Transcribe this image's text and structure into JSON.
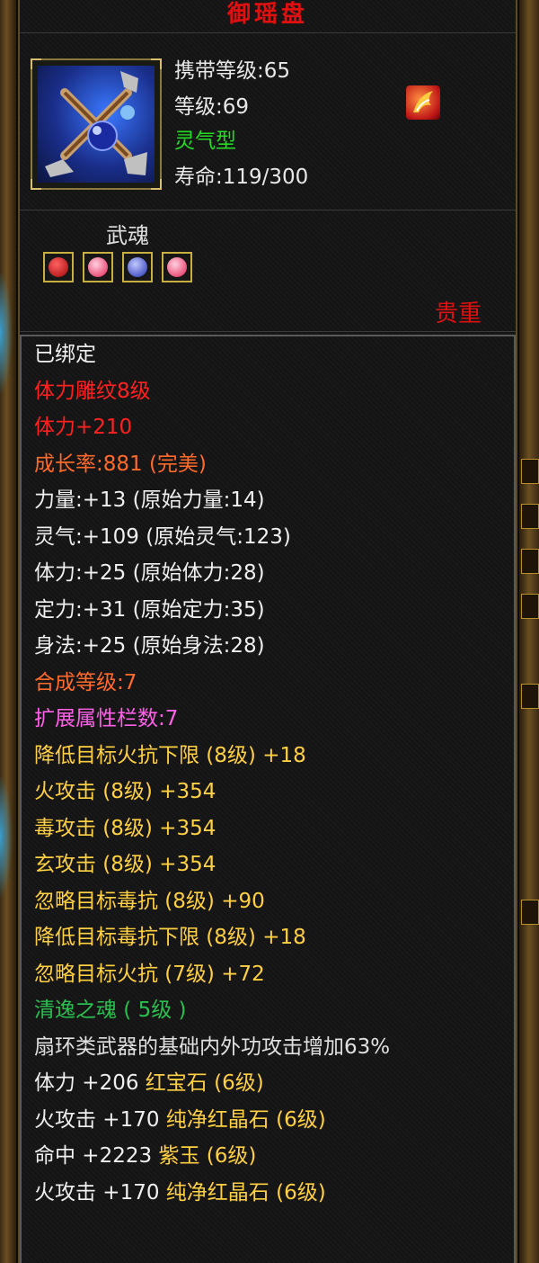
{
  "title": "御瑶盘",
  "item_icon": "fan-weapon-icon",
  "stats": [
    {
      "text": "携带等级:65",
      "color": "#e8e8e8"
    },
    {
      "text": "等级:69",
      "color": "#e8e8e8"
    },
    {
      "text": "灵气型",
      "color": "#22dd22"
    },
    {
      "text": "寿命:119/300",
      "color": "#e8e8e8"
    }
  ],
  "rarity_icon": "phoenix-flame-icon",
  "soul": {
    "label": "武魂",
    "gems": [
      {
        "icon": "red-soul-gem-icon",
        "color": "#cc1010"
      },
      {
        "icon": "fire-soul-gem-icon",
        "color": "#ff3060"
      },
      {
        "icon": "blue-soul-gem-icon",
        "color": "#3040d0"
      },
      {
        "icon": "fire-soul-gem-icon",
        "color": "#ff3060"
      }
    ]
  },
  "quality": "贵重",
  "attributes": [
    {
      "text": "已绑定",
      "color": "#f0f0f0"
    },
    {
      "text": "体力雕纹8级",
      "color": "#ff2020"
    },
    {
      "text": "体力+210",
      "color": "#ff2020"
    },
    {
      "text": "成长率:881 (完美)",
      "color": "#ff6a28"
    },
    {
      "text": "力量:+13 (原始力量:14)",
      "color": "#f0f0f0"
    },
    {
      "text": "灵气:+109 (原始灵气:123)",
      "color": "#f0f0f0"
    },
    {
      "text": "体力:+25 (原始体力:28)",
      "color": "#f0f0f0"
    },
    {
      "text": "定力:+31 (原始定力:35)",
      "color": "#f0f0f0"
    },
    {
      "text": "身法:+25 (原始身法:28)",
      "color": "#f0f0f0"
    },
    {
      "text": "合成等级:7",
      "color": "#ff6a28"
    },
    {
      "text": "扩展属性栏数:7",
      "color": "#ff60e8"
    },
    {
      "text": "降低目标火抗下限 (8级) +18",
      "color": "#ffd040"
    },
    {
      "text": "火攻击 (8级) +354",
      "color": "#ffd040"
    },
    {
      "text": "毒攻击 (8级) +354",
      "color": "#ffd040"
    },
    {
      "text": "玄攻击 (8级) +354",
      "color": "#ffd040"
    },
    {
      "text": "忽略目标毒抗 (8级) +90",
      "color": "#ffd040"
    },
    {
      "text": "降低目标毒抗下限 (8级) +18",
      "color": "#ffd040"
    },
    {
      "text": "忽略目标火抗 (7级) +72",
      "color": "#ffd040"
    },
    {
      "text": "清逸之魂 ( 5级 )",
      "color": "#28c050"
    },
    {
      "text": "扇环类武器的基础内外功攻击增加63%",
      "color": "#e0e0e0"
    },
    {
      "parts": [
        {
          "text": "体力 +206 ",
          "color": "#f0f0f0"
        },
        {
          "text": "红宝石 (6级)",
          "color": "#ffd040"
        }
      ]
    },
    {
      "parts": [
        {
          "text": "火攻击 +170 ",
          "color": "#f0f0f0"
        },
        {
          "text": "纯净红晶石 (6级)",
          "color": "#ffd040"
        }
      ]
    },
    {
      "parts": [
        {
          "text": "命中 +2223 ",
          "color": "#f0f0f0"
        },
        {
          "text": "紫玉 (6级)",
          "color": "#ffd040"
        }
      ]
    },
    {
      "parts": [
        {
          "text": "火攻击 +170 ",
          "color": "#f0f0f0"
        },
        {
          "text": "纯净红晶石 (6级)",
          "color": "#ffd040"
        }
      ]
    }
  ]
}
